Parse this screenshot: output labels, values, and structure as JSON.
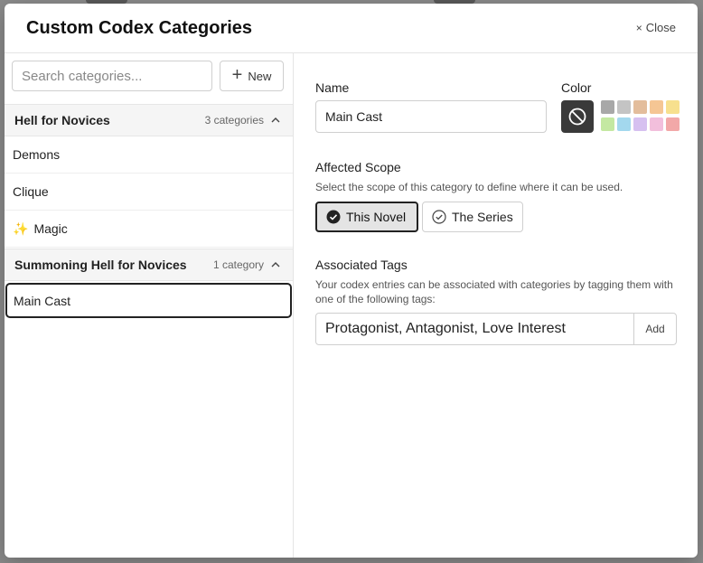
{
  "modal": {
    "title": "Custom Codex Categories",
    "close_label": "Close"
  },
  "left": {
    "search_placeholder": "Search categories...",
    "new_label": "New",
    "groups": [
      {
        "name": "Hell for Novices",
        "count": "3 categories",
        "items": [
          {
            "label": "Demons",
            "emoji": ""
          },
          {
            "label": "Clique",
            "emoji": ""
          },
          {
            "label": "Magic",
            "emoji": "✨"
          }
        ]
      },
      {
        "name": "Summoning Hell for Novices",
        "count": "1 category",
        "items": [
          {
            "label": "Main Cast",
            "emoji": "",
            "selected": true
          }
        ]
      }
    ]
  },
  "right": {
    "name_label": "Name",
    "name_value": "Main Cast",
    "color_label": "Color",
    "colors": [
      "#a8a8a8",
      "#c4c4c4",
      "#e3bd9c",
      "#f5c694",
      "#f7e08e",
      "#c4e8a2",
      "#a3d8ee",
      "#d6c0f0",
      "#f2bfdc",
      "#f2a8a8"
    ],
    "scope_label": "Affected Scope",
    "scope_desc": "Select the scope of this category to define where it can be used.",
    "scope_options": [
      {
        "label": "This Novel",
        "active": true
      },
      {
        "label": "The Series",
        "active": false
      }
    ],
    "tags_label": "Associated Tags",
    "tags_desc": "Your codex entries can be associated with categories by tagging them with one of the following tags:",
    "tags_value": "Protagonist, Antagonist, Love Interest",
    "add_label": "Add"
  }
}
